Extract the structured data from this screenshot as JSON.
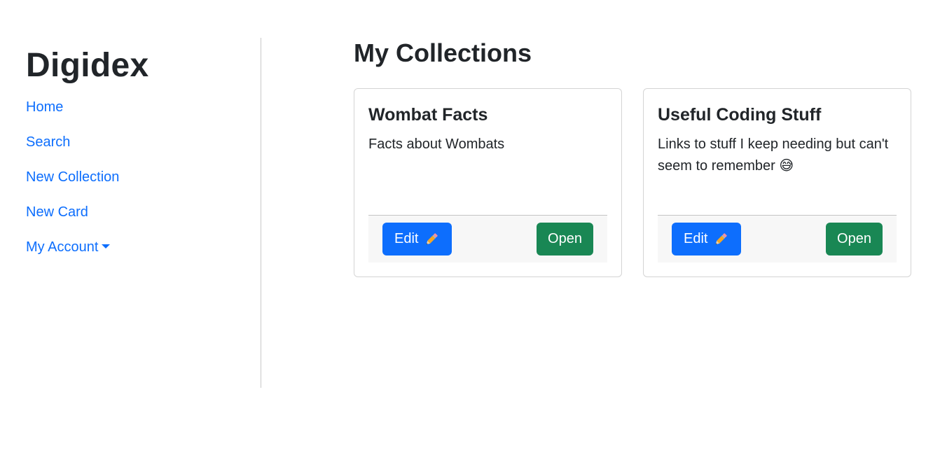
{
  "sidebar": {
    "brand": "Digidex",
    "nav": [
      {
        "label": "Home"
      },
      {
        "label": "Search"
      },
      {
        "label": "New Collection"
      },
      {
        "label": "New Card"
      },
      {
        "label": "My Account"
      }
    ]
  },
  "main": {
    "title": "My Collections",
    "cards": [
      {
        "title": "Wombat Facts",
        "description": "Facts about Wombats",
        "edit_label": "Edit",
        "open_label": "Open"
      },
      {
        "title": "Useful Coding Stuff",
        "description": "Links to stuff I keep needing but can't seem to remember",
        "emoji": "😅",
        "edit_label": "Edit",
        "open_label": "Open"
      }
    ]
  },
  "colors": {
    "link": "#0d6efd",
    "primary": "#0d6efd",
    "success": "#198754"
  },
  "icons": {
    "edit_icon": "pencil-icon",
    "account_dropdown": "caret-down-icon"
  }
}
